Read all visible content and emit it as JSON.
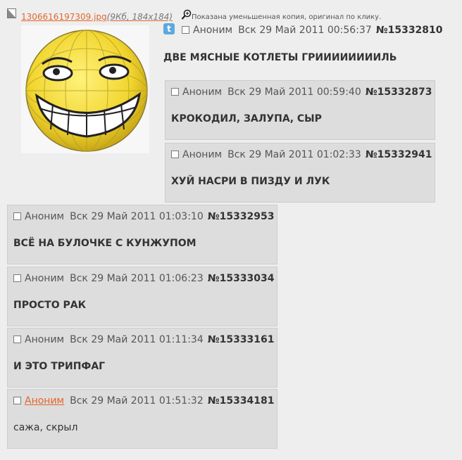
{
  "file": {
    "name": "1306616197309.jpg",
    "meta": "(9Кб, 184x184)",
    "thumb_note": "Показана уменьшенная копия, оригинал по клику."
  },
  "op": {
    "name": "Аноним",
    "date": "Вск 29 Май 2011 00:56:37",
    "number": "№15332810",
    "text": "ДВЕ МЯСНЫЕ КОТЛЕТЫ ГРИИИИИИИИЛЬ"
  },
  "replies": [
    {
      "name": "Аноним",
      "date": "Вск 29 Май 2011 00:59:40",
      "number": "№15332873",
      "text": "КРОКОДИЛ, ЗАЛУПА, СЫР"
    },
    {
      "name": "Аноним",
      "date": "Вск 29 Май 2011 01:02:33",
      "number": "№15332941",
      "text": "ХУЙ НАСРИ В ПИЗДУ И ЛУК"
    },
    {
      "name": "Аноним",
      "date": "Вск 29 Май 2011 01:03:10",
      "number": "№15332953",
      "text": "ВСЁ НА БУЛОЧКЕ С КУНЖУПОМ"
    },
    {
      "name": "Аноним",
      "date": "Вск 29 Май 2011 01:06:23",
      "number": "№15333034",
      "text": "ПРОСТО РАК"
    },
    {
      "name": "Аноним",
      "date": "Вск 29 Май 2011 01:11:34",
      "number": "№15333161",
      "text": "И ЭТО ТРИПФАГ"
    },
    {
      "name": "Аноним",
      "date": "Вск 29 Май 2011 01:51:32",
      "number": "№15334181",
      "text": "сажа, скрыл"
    }
  ],
  "colors": {
    "link": "#e4662a",
    "reply_bg": "#dddddd",
    "page_bg": "#eeeeee"
  }
}
